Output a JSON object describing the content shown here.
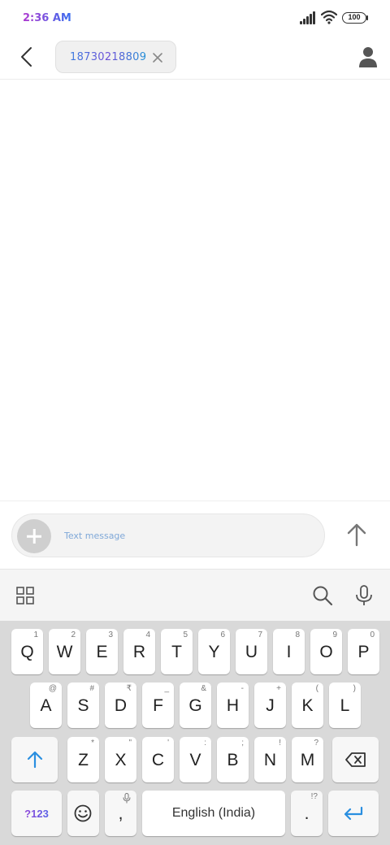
{
  "status_bar": {
    "time": "2:36 AM",
    "battery": "100"
  },
  "header": {
    "recipient_number": "18730218809"
  },
  "composer": {
    "placeholder": "Text message"
  },
  "keyboard": {
    "row1": [
      {
        "k": "Q",
        "h": "1"
      },
      {
        "k": "W",
        "h": "2"
      },
      {
        "k": "E",
        "h": "3"
      },
      {
        "k": "R",
        "h": "4"
      },
      {
        "k": "T",
        "h": "5"
      },
      {
        "k": "Y",
        "h": "6"
      },
      {
        "k": "U",
        "h": "7"
      },
      {
        "k": "I",
        "h": "8"
      },
      {
        "k": "O",
        "h": "9"
      },
      {
        "k": "P",
        "h": "0"
      }
    ],
    "row2": [
      {
        "k": "A",
        "h": "@"
      },
      {
        "k": "S",
        "h": "#"
      },
      {
        "k": "D",
        "h": "₹"
      },
      {
        "k": "F",
        "h": "_"
      },
      {
        "k": "G",
        "h": "&"
      },
      {
        "k": "H",
        "h": "-"
      },
      {
        "k": "J",
        "h": "+"
      },
      {
        "k": "K",
        "h": "("
      },
      {
        "k": "L",
        "h": ")"
      }
    ],
    "row3": [
      {
        "k": "Z",
        "h": "*"
      },
      {
        "k": "X",
        "h": "\""
      },
      {
        "k": "C",
        "h": "'"
      },
      {
        "k": "V",
        "h": ":"
      },
      {
        "k": "B",
        "h": ";"
      },
      {
        "k": "N",
        "h": "!"
      },
      {
        "k": "M",
        "h": "?"
      }
    ],
    "symbols_key": "?123",
    "comma_key": ",",
    "space_label": "English (India)",
    "period_key": ".",
    "period_hint": "!?"
  }
}
